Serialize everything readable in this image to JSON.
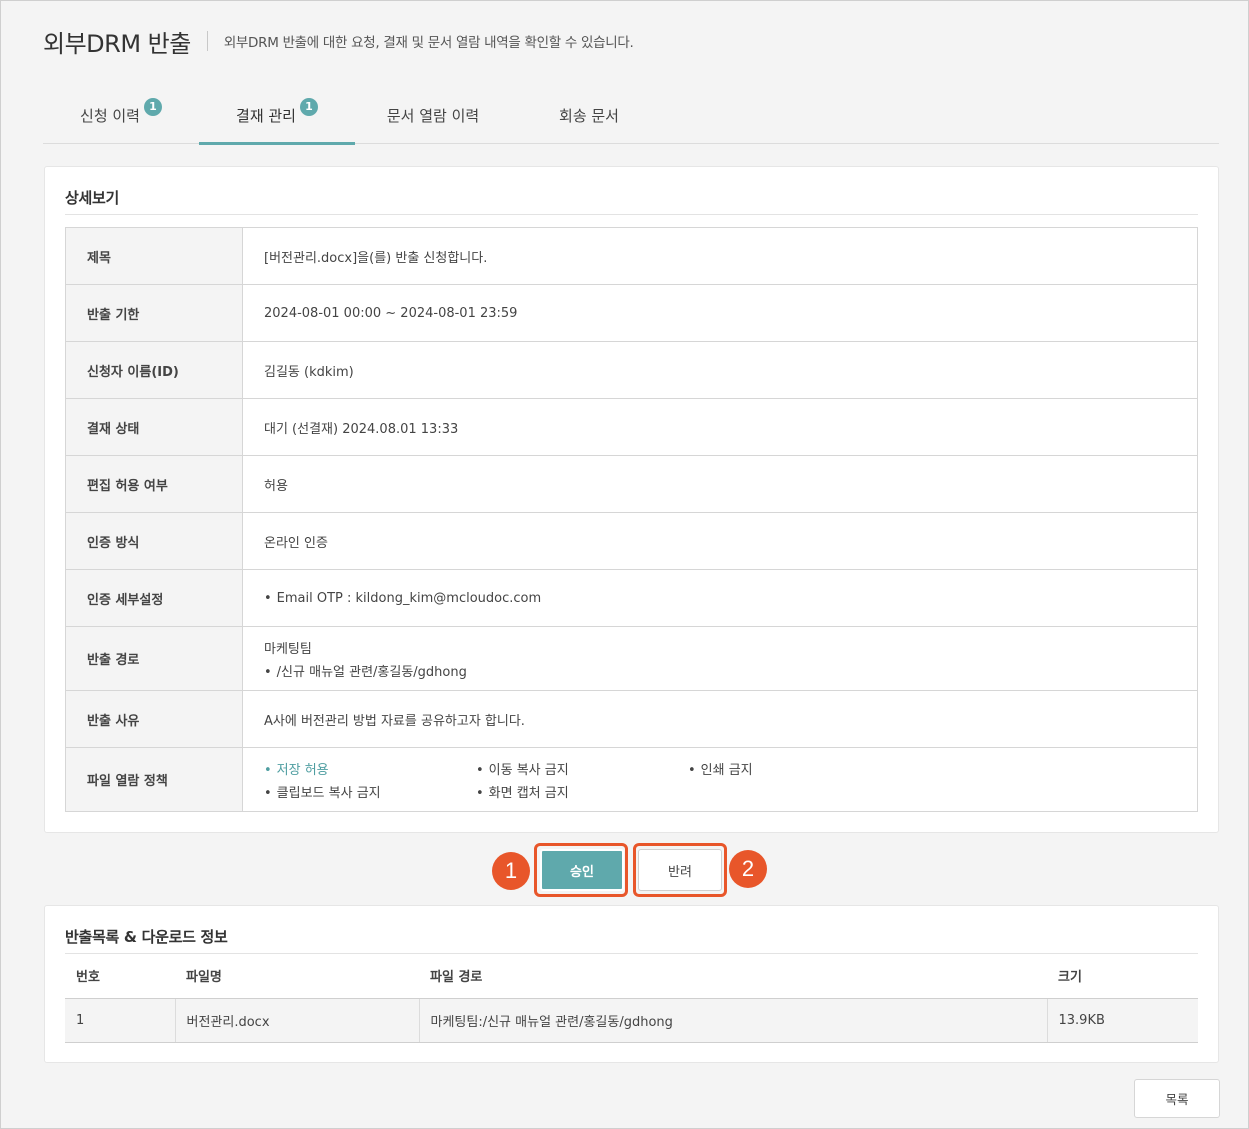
{
  "header": {
    "title": "외부DRM 반출",
    "description": "외부DRM 반출에 대한 요청, 결재 및 문서 열람 내역을 확인할 수 있습니다."
  },
  "tabs": [
    {
      "label": "신청 이력",
      "badge": "1"
    },
    {
      "label": "결재 관리",
      "badge": "1",
      "active": true
    },
    {
      "label": "문서 열람 이력"
    },
    {
      "label": "회송 문서"
    }
  ],
  "detail": {
    "section_title": "상세보기",
    "rows": {
      "subject": {
        "label": "제목",
        "value": "[버전관리.docx]을(를) 반출 신청합니다."
      },
      "deadline": {
        "label": "반출 기한",
        "value": "2024-08-01 00:00 ~ 2024-08-01 23:59"
      },
      "applicant": {
        "label": "신청자 이름(ID)",
        "value": "김길동 (kdkim)"
      },
      "approval_status": {
        "label": "결재 상태",
        "value": "대기 (선결재) 2024.08.01 13:33"
      },
      "edit_allowed": {
        "label": "편집 허용 여부",
        "value": "허용"
      },
      "auth_method": {
        "label": "인증 방식",
        "value": "온라인 인증"
      },
      "auth_detail": {
        "label": "인증 세부설정",
        "value": "Email OTP : kildong_kim@mcloudoc.com"
      },
      "export_path": {
        "label": "반출 경로",
        "line1": "마케팅팀",
        "line2": "/신규 매뉴얼 관련/홍길동/gdhong"
      },
      "export_reason": {
        "label": "반출 사유",
        "value": "A사에 버전관리 방법 자료를 공유하고자 합니다."
      },
      "file_policy": {
        "label": "파일 열람 정책",
        "items": [
          "저장 허용",
          "이동 복사 금지",
          "인쇄 금지",
          "클립보드 복사 금지",
          "화면 캡처 금지"
        ]
      }
    }
  },
  "actions": {
    "approve_label": "승인",
    "reject_label": "반려",
    "callout_1": "1",
    "callout_2": "2",
    "accent_color": "#5fa9ac",
    "callout_color": "#e8562a"
  },
  "downloads": {
    "section_title": "반출목록 & 다운로드 정보",
    "columns": [
      "번호",
      "파일명",
      "파일 경로",
      "크기"
    ],
    "rows": [
      [
        "1",
        "버전관리.docx",
        "마케팅팀:/신규 매뉴얼 관련/홍길동/gdhong",
        "13.9KB"
      ]
    ]
  },
  "footer": {
    "list_button_label": "목록"
  }
}
